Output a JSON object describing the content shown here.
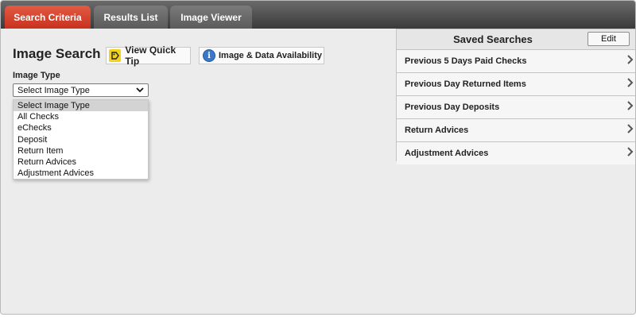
{
  "tabs": [
    {
      "label": "Search Criteria",
      "active": true
    },
    {
      "label": "Results List",
      "active": false
    },
    {
      "label": "Image Viewer",
      "active": false
    }
  ],
  "main": {
    "title": "Image Search",
    "quick_tip_label": "View Quick Tip",
    "availability_label": "Image & Data Availability",
    "image_type_label": "Image Type",
    "image_type_selected": "Select Image Type",
    "image_type_options": [
      "Select Image Type",
      "All Checks",
      "eChecks",
      "Deposit",
      "Return Item",
      "Return Advices",
      "Adjustment Advices"
    ]
  },
  "saved_searches": {
    "title": "Saved Searches",
    "edit_label": "Edit",
    "items": [
      "Previous 5 Days Paid Checks",
      "Previous Day Returned Items",
      "Previous Day Deposits",
      "Return Advices",
      "Adjustment Advices"
    ]
  },
  "icons": {
    "quick_tip": "tag-icon",
    "availability": "info-icon",
    "select_chevron": "chevron-down-icon",
    "item_chevron": "chevron-right-icon"
  },
  "colors": {
    "active_tab": "#d23a25",
    "inactive_tab": "#6b6b6b",
    "tabbar": "#4a4a4a",
    "background": "#ececec"
  }
}
